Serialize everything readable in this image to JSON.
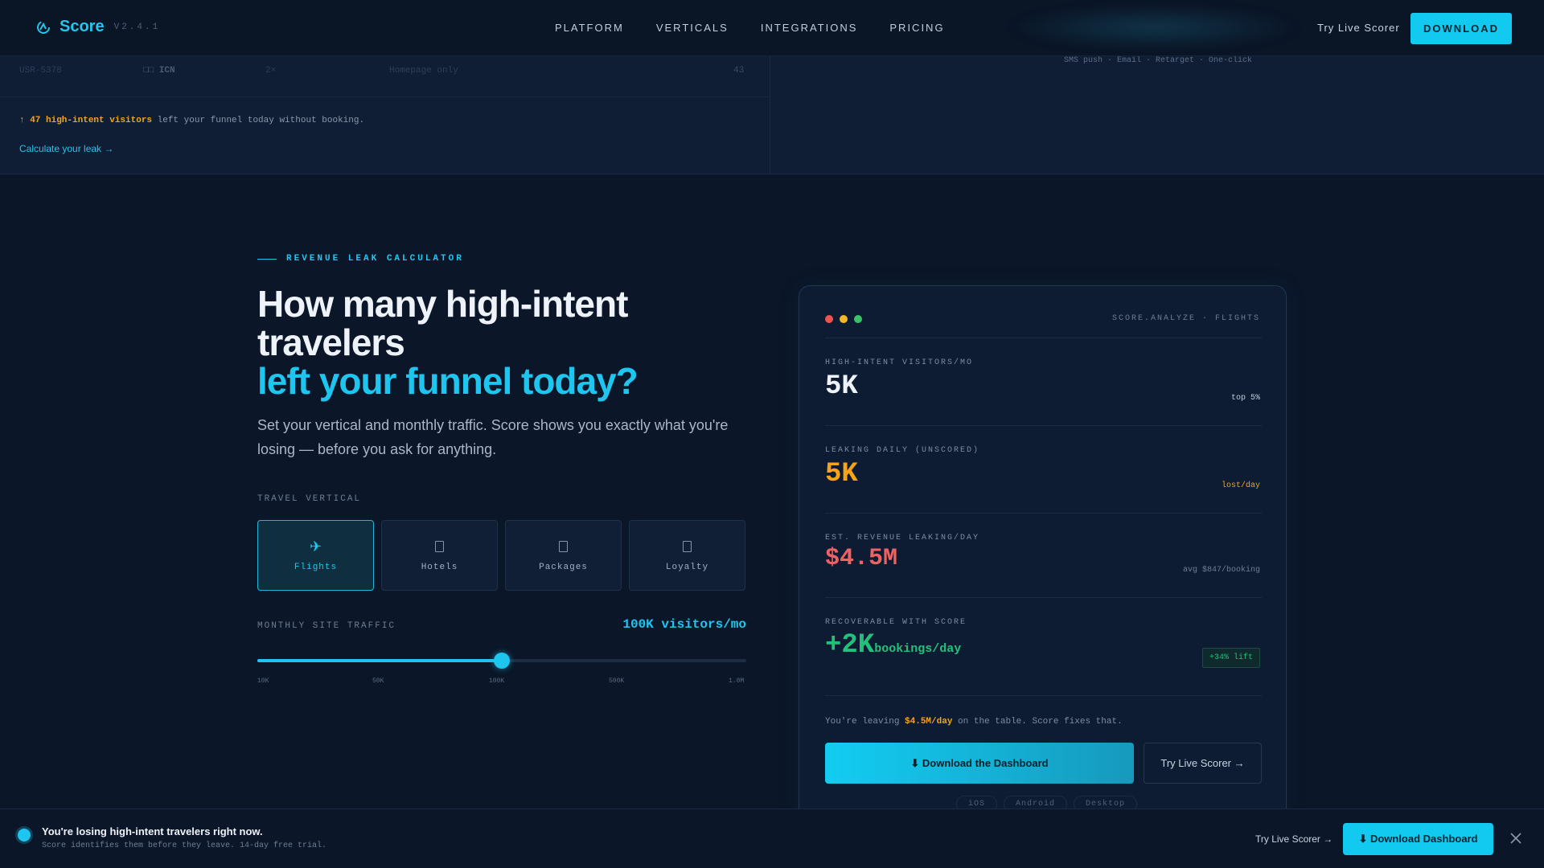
{
  "nav": {
    "brand": "Score",
    "version": "V2.4.1",
    "links": [
      "PLATFORM",
      "VERTICALS",
      "INTEGRATIONS",
      "PRICING"
    ],
    "try_label": "Try Live Scorer",
    "download_label": "DOWNLOAD"
  },
  "strip": {
    "row": [
      "USR-5378",
      "ICN",
      "2×",
      "Homepage only",
      "43"
    ],
    "alert_highlight": "↑ 47 high-intent visitors",
    "alert_rest": " left your funnel today without booking.",
    "link": "Calculate your leak  →",
    "right_text": "SMS push · Email · Retarget · One-click"
  },
  "hero": {
    "eyebrow": "REVENUE LEAK CALCULATOR",
    "title_line1": "How many high-intent travelers",
    "title_accent": "left your funnel today?",
    "subtitle": "Set your vertical and monthly traffic. Score shows you exactly what you're losing — before you ask for anything.",
    "vertical_label": "TRAVEL VERTICAL",
    "verticals": [
      {
        "label": "Flights",
        "icon": "plane-icon",
        "active": true
      },
      {
        "label": "Hotels",
        "icon": "hotel-icon",
        "active": false
      },
      {
        "label": "Packages",
        "icon": "package-icon",
        "active": false
      },
      {
        "label": "Loyalty",
        "icon": "loyalty-icon",
        "active": false
      }
    ],
    "traffic_label": "MONTHLY SITE TRAFFIC",
    "traffic_value": "100K visitors/mo",
    "slider_fraction": 0.5,
    "slider_ticks": [
      "10K",
      "50K",
      "100K",
      "500K",
      "1.0M"
    ]
  },
  "panel": {
    "tag": "SCORE.ANALYZE · FLIGHTS",
    "dot_colors": [
      "#ef5350",
      "#f5b72a",
      "#3bc06b"
    ],
    "metrics": {
      "visitors_label": "HIGH-INTENT VISITORS/MO",
      "visitors_value": "5K",
      "visitors_note": "top 5%",
      "leaking_label": "LEAKING DAILY (UNSCORED)",
      "leaking_value": "5K",
      "leaking_note": "lost/day",
      "revenue_label": "EST. REVENUE LEAKING/DAY",
      "revenue_value": "$4.5M",
      "revenue_note": "avg $847/booking",
      "recover_label": "RECOVERABLE WITH SCORE",
      "recover_value": "+2K",
      "recover_unit": "bookings/day",
      "lift": "+34% lift"
    },
    "leave_prefix": "You're leaving ",
    "leave_amount": "$4.5M/day",
    "leave_suffix": " on the table. Score fixes that.",
    "primary_button": "⬇ Download the Dashboard",
    "secondary_button": "Try Live Scorer →",
    "platforms": [
      "iOS",
      "Android",
      "Desktop"
    ]
  },
  "bottombar": {
    "title": "You're losing high-intent travelers right now.",
    "subtitle": "Score identifies them before they leave. 14-day free trial.",
    "try_label": "Try Live Scorer →",
    "button": "⬇ Download Dashboard"
  },
  "colors": {
    "accent": "#1ec6ef",
    "warning": "#f5a31a",
    "danger": "#f06262",
    "success": "#22c07a"
  }
}
